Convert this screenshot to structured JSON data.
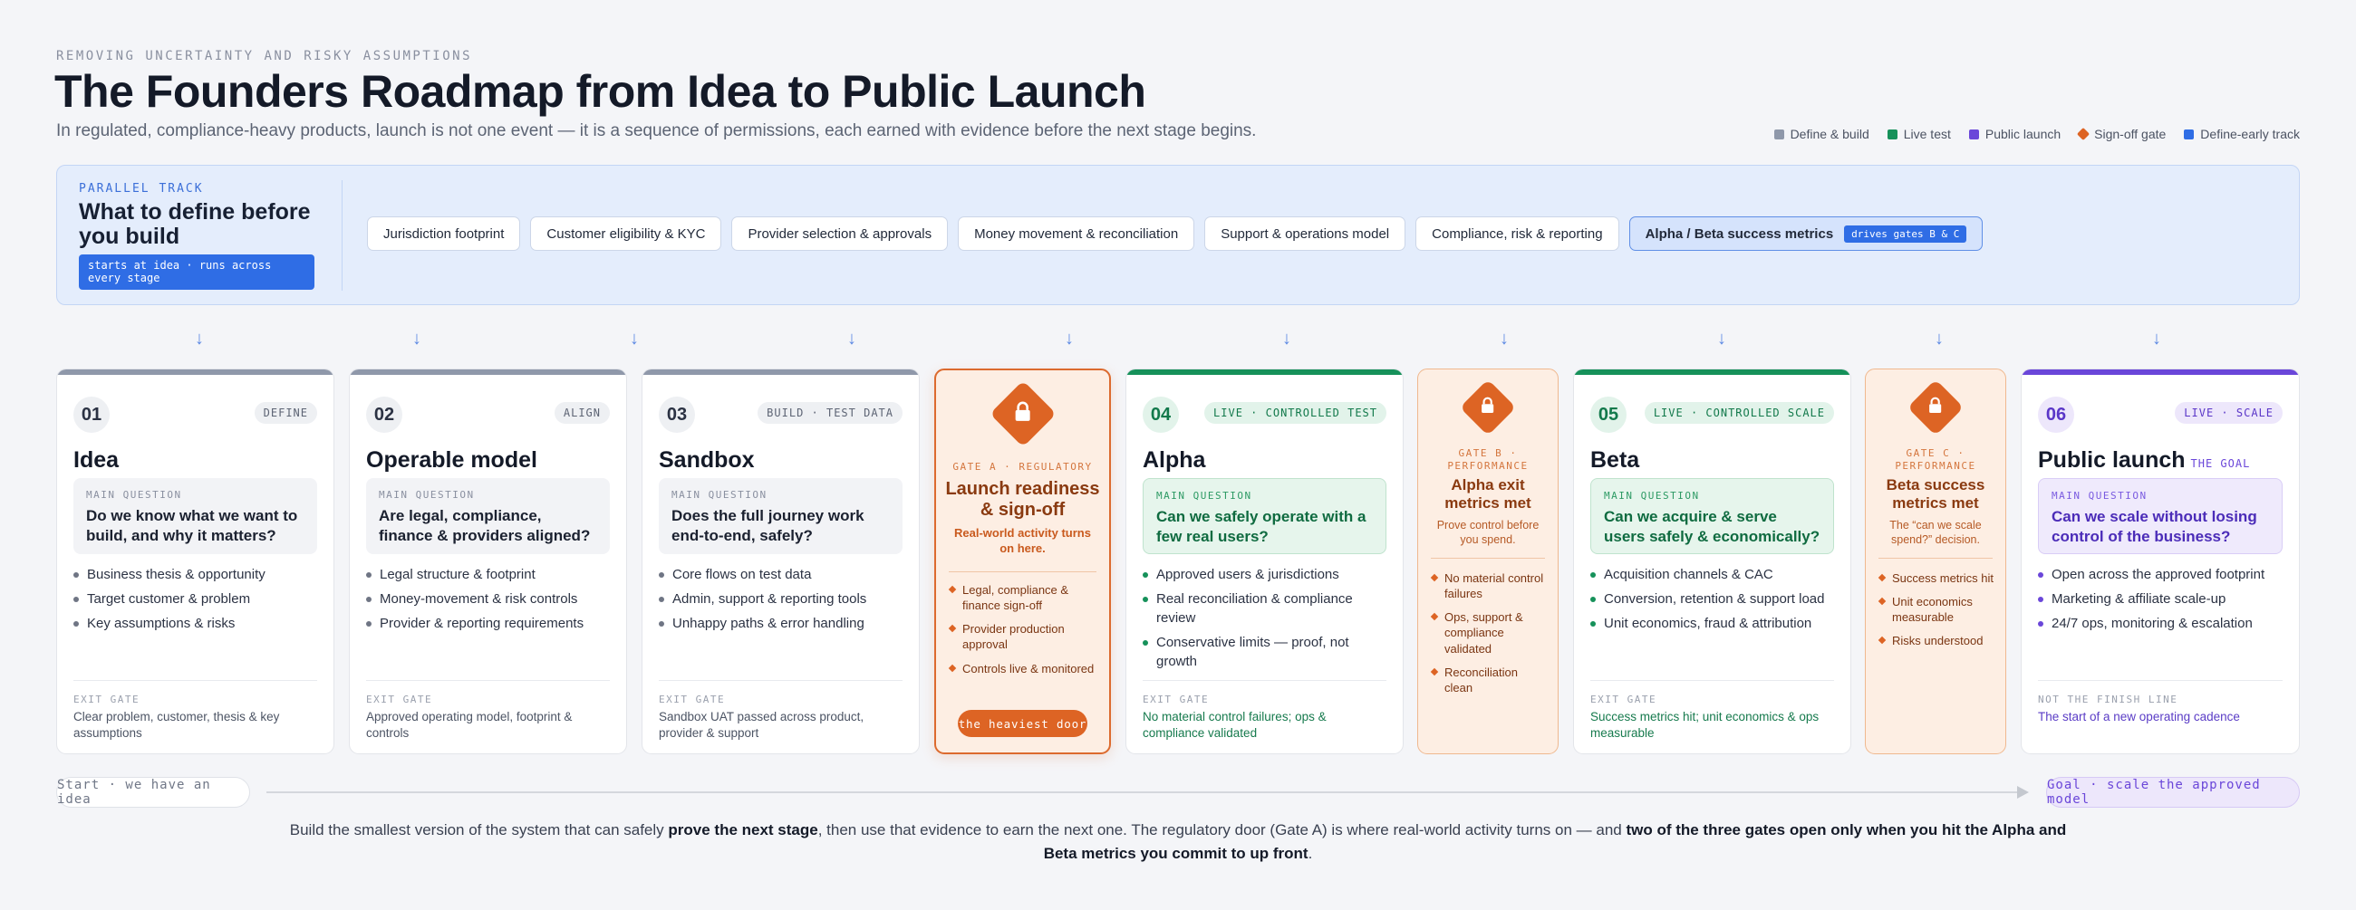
{
  "header": {
    "eyebrow": "REMOVING UNCERTAINTY AND RISKY ASSUMPTIONS",
    "title": "The Founders Roadmap from Idea to Public Launch",
    "subtitle": "In regulated, compliance-heavy products, launch is not one event — it is a sequence of permissions, each earned with evidence before the next stage begins."
  },
  "legend": [
    {
      "label": "Define & build",
      "color": "#8f98aa",
      "shape": "square"
    },
    {
      "label": "Live test",
      "color": "#16915a",
      "shape": "square"
    },
    {
      "label": "Public launch",
      "color": "#6a46d9",
      "shape": "square"
    },
    {
      "label": "Sign-off gate",
      "color": "#dd6424",
      "shape": "diamond"
    },
    {
      "label": "Define-early track",
      "color": "#2f6de5",
      "shape": "square"
    }
  ],
  "track": {
    "eyebrow": "PARALLEL TRACK",
    "title": "What to define before you build",
    "badge": "starts at idea · runs across every stage",
    "chips": [
      "Jurisdiction footprint",
      "Customer eligibility & KYC",
      "Provider selection & approvals",
      "Money movement & reconciliation",
      "Support & operations model",
      "Compliance, risk & reporting"
    ],
    "highlight_chip": {
      "label": "Alpha / Beta success metrics",
      "badge": "drives gates B & C"
    }
  },
  "arrow_glyph": "↓",
  "question_label": "MAIN QUESTION",
  "exit_label": "EXIT GATE",
  "stages": {
    "idea": {
      "num": "01",
      "tag": "DEFINE",
      "title": "Idea",
      "question": "Do we know what we want to build, and why it matters?",
      "bullets": [
        "Business thesis & opportunity",
        "Target customer & problem",
        "Key assumptions & risks"
      ],
      "exit": "Clear problem, customer, thesis & key assumptions"
    },
    "operable": {
      "num": "02",
      "tag": "ALIGN",
      "title": "Operable model",
      "question": "Are legal, compliance, finance & providers aligned?",
      "bullets": [
        "Legal structure & footprint",
        "Money-movement & risk controls",
        "Provider & reporting requirements"
      ],
      "exit": "Approved operating model, footprint & controls"
    },
    "sandbox": {
      "num": "03",
      "tag": "BUILD · TEST DATA",
      "title": "Sandbox",
      "question": "Does the full journey work end-to-end, safely?",
      "bullets": [
        "Core flows on test data",
        "Admin, support & reporting tools",
        "Unhappy paths & error handling"
      ],
      "exit": "Sandbox UAT passed across product, provider & support"
    },
    "alpha": {
      "num": "04",
      "tag": "LIVE · CONTROLLED TEST",
      "title": "Alpha",
      "question": "Can we safely operate with a few real users?",
      "bullets": [
        "Approved users & jurisdictions",
        "Real reconciliation & compliance review",
        "Conservative limits — proof, not growth"
      ],
      "exit": "No material control failures; ops & compliance validated"
    },
    "beta": {
      "num": "05",
      "tag": "LIVE · CONTROLLED SCALE",
      "title": "Beta",
      "question": "Can we acquire & serve users safely & economically?",
      "bullets": [
        "Acquisition channels & CAC",
        "Conversion, retention & support load",
        "Unit economics, fraud & attribution"
      ],
      "exit": "Success metrics hit; unit economics & ops measurable"
    },
    "launch": {
      "num": "06",
      "tag": "LIVE · SCALE",
      "title": "Public launch",
      "goal": "THE GOAL",
      "question": "Can we scale without losing control of the business?",
      "bullets": [
        "Open across the approved footprint",
        "Marketing & affiliate scale-up",
        "24/7 ops, monitoring & escalation"
      ],
      "exit_label": "NOT THE FINISH LINE",
      "exit": "The start of a new operating cadence"
    }
  },
  "gates": {
    "a": {
      "tag": "GATE A · REGULATORY",
      "title": "Launch readiness & sign-off",
      "sub": "Real-world activity turns on here.",
      "bullets": [
        "Legal, compliance & finance sign-off",
        "Provider production approval",
        "Controls live & monitored"
      ],
      "cta": "the heaviest door"
    },
    "b": {
      "tag": "GATE B · PERFORMANCE",
      "title": "Alpha exit metrics met",
      "sub": "Prove control before you spend.",
      "bullets": [
        "No material control failures",
        "Ops, support & compliance validated",
        "Reconciliation clean"
      ]
    },
    "c": {
      "tag": "GATE C · PERFORMANCE",
      "title": "Beta success metrics met",
      "sub": "The “can we scale spend?” decision.",
      "bullets": [
        "Success metrics hit",
        "Unit economics measurable",
        "Risks understood"
      ]
    }
  },
  "timeline": {
    "start": "Start · we have an idea",
    "goal": "Goal · scale the approved model"
  },
  "footnote": {
    "p1": "Build the smallest version of the system that can safely ",
    "b1": "prove the next stage",
    "p2": ", then use that evidence to earn the next one. The regulatory door (Gate A) is where real-world activity turns on — and ",
    "b2": "two of the three gates open only when you hit the Alpha and Beta metrics you commit to up front",
    "p3": "."
  },
  "colors": {
    "define": "#8f98aa",
    "live": "#16915a",
    "launch": "#6a46d9",
    "gate": "#dd6424",
    "track": "#2f6de5"
  }
}
